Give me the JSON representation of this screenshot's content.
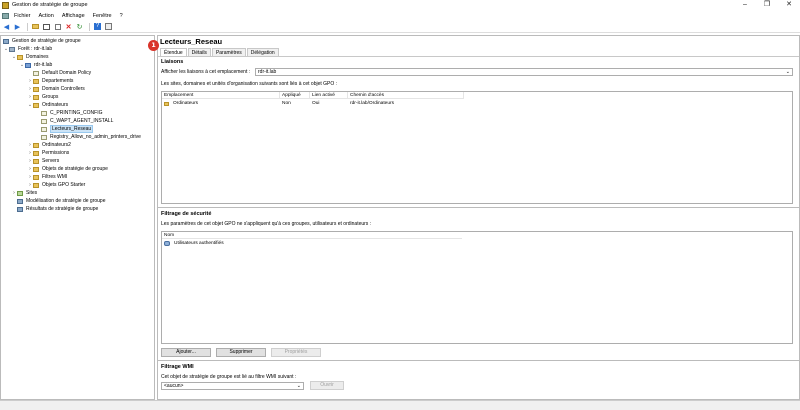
{
  "window": {
    "title": "Gestion de stratégie de groupe"
  },
  "menu": [
    "Fichier",
    "Action",
    "Affichage",
    "Fenêtre",
    "?"
  ],
  "tree": {
    "items": [
      {
        "label": "Gestion de stratégie de groupe",
        "icon": "console-icon"
      },
      {
        "label": "Forêt : rdr-it.lab",
        "icon": "forest-icon"
      },
      {
        "label": "Domaines",
        "icon": "folder-icon"
      },
      {
        "label": "rdr-it.lab",
        "icon": "domain-icon"
      },
      {
        "label": "Default Domain Policy",
        "icon": "gpo-link-icon"
      },
      {
        "label": "Departements",
        "icon": "folder-icon"
      },
      {
        "label": "Domain Controllers",
        "icon": "folder-icon"
      },
      {
        "label": "Groups",
        "icon": "folder-icon"
      },
      {
        "label": "Ordinateurs",
        "icon": "folder-icon"
      },
      {
        "label": "C_PRINTING_CONFIG",
        "icon": "gpo-link-icon"
      },
      {
        "label": "C_WAPT_AGENT_INSTALL",
        "icon": "gpo-link-icon"
      },
      {
        "label": "Lecteurs_Reseau",
        "icon": "gpo-link-icon"
      },
      {
        "label": "Registry_Allow_no_admin_printers_drive",
        "icon": "gpo-link-icon"
      },
      {
        "label": "Ordinateurs2",
        "icon": "folder-icon"
      },
      {
        "label": "Permissions",
        "icon": "folder-icon"
      },
      {
        "label": "Servers",
        "icon": "folder-icon"
      },
      {
        "label": "Objets de stratégie de groupe",
        "icon": "folder-icon"
      },
      {
        "label": "Filtres WMI",
        "icon": "folder-icon"
      },
      {
        "label": "Objets GPO Starter",
        "icon": "folder-icon"
      },
      {
        "label": "Sites",
        "icon": "site-icon"
      },
      {
        "label": "Modélisation de stratégie de groupe",
        "icon": "console-icon"
      },
      {
        "label": "Résultats de stratégie de groupe",
        "icon": "console-icon"
      }
    ]
  },
  "gpo": {
    "title": "Lecteurs_Reseau",
    "tabs": [
      "Étendue",
      "Détails",
      "Paramètres",
      "Délégation"
    ],
    "badge": "1"
  },
  "links": {
    "heading": "Liaisons",
    "location_label": "Afficher les liaisons à cet emplacement :",
    "location_value": "rdr-it.lab",
    "desc": "Les sites, domaines et unités d'organisation suivants sont liés à cet objet GPO :",
    "columns": [
      "Emplacement",
      "Appliqué",
      "Lien activé",
      "Chemin d'accès"
    ],
    "rows": [
      {
        "location": "Ordinateurs",
        "enforced": "Non",
        "enabled": "Oui",
        "path": "rdr-it.lab/Ordinateurs"
      }
    ]
  },
  "security": {
    "heading": "Filtrage de sécurité",
    "desc": "Les paramètres de cet objet GPO ne s'appliquent qu'à ces groupes, utilisateurs et ordinateurs :",
    "column": "Nom",
    "rows": [
      "Utilisateurs authentifiés"
    ],
    "add": "Ajouter...",
    "remove": "Supprimer",
    "properties": "Propriétés"
  },
  "wmi": {
    "heading": "Filtrage WMI",
    "desc": "Cet objet de stratégie de groupe est lié au filtre WMI suivant :",
    "value": "<aucun>",
    "open": "Ouvrir"
  }
}
